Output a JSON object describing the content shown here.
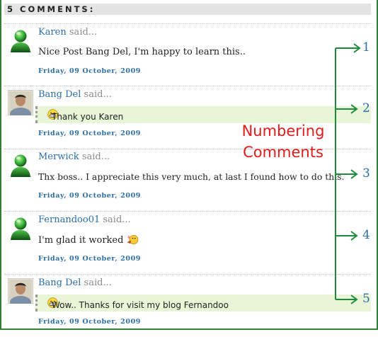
{
  "header": {
    "title": "5 COMMENTS:"
  },
  "comments": [
    {
      "author": "Karen",
      "said": "said...",
      "text": "Nice Post Bang Del, I'm happy to learn this..",
      "date": "Friday, 09 October, 2009",
      "avatar": "green-user-icon",
      "is_reply": false,
      "emoticon": ""
    },
    {
      "author": "Bang Del",
      "said": "said...",
      "text": "Thank you Karen",
      "date": "Friday, 09 October, 2009",
      "avatar": "photo-avatar",
      "is_reply": true,
      "emoticon": "grin-emoticon"
    },
    {
      "author": "Merwick",
      "said": "said...",
      "text": "Thx boss.. I appreciate this very much, at last I found how to do this.",
      "date": "Friday, 09 October, 2009",
      "avatar": "green-user-icon",
      "is_reply": false,
      "emoticon": ""
    },
    {
      "author": "Fernandoo01",
      "said": "said...",
      "text": "I'm glad it worked",
      "date": "Friday, 09 October, 2009",
      "avatar": "green-user-icon",
      "is_reply": false,
      "emoticon": "party-emoticon"
    },
    {
      "author": "Bang Del",
      "said": "said...",
      "text": "Wow.. Thanks for visit my blog Fernandoo",
      "date": "Friday, 09 October, 2009",
      "avatar": "photo-avatar",
      "is_reply": true,
      "emoticon": "grin-emoticon"
    }
  ],
  "annotation": {
    "label_line1": "Numbering",
    "label_line2": "Comments",
    "numbers": [
      "1",
      "2",
      "3",
      "4",
      "5"
    ],
    "color_label": "#e21b1b",
    "color_arrows": "#1e8a3a",
    "color_numbers": "#2a6ea6"
  }
}
